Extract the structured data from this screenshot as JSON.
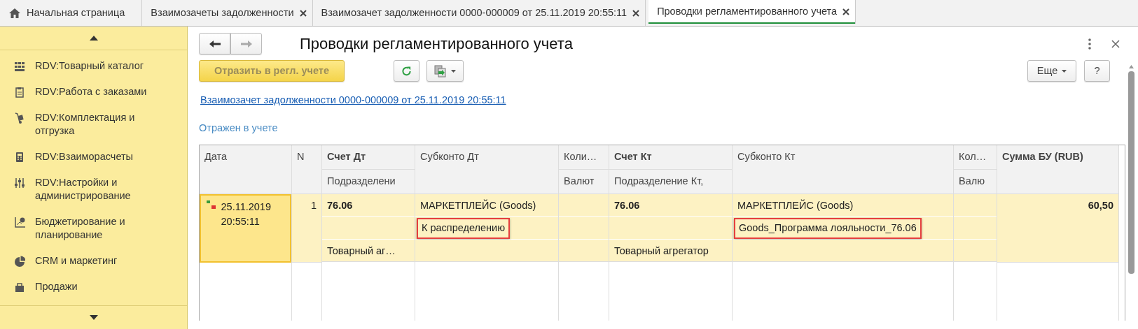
{
  "tabs": [
    {
      "label": "Начальная страница",
      "kind": "home",
      "selected": false
    },
    {
      "label": "Взаимозачеты задолженности",
      "kind": "doc",
      "selected": false
    },
    {
      "label": "Взаимозачет задолженности 0000-000009 от 25.11.2019 20:55:11",
      "kind": "doc",
      "selected": false
    },
    {
      "label": "Проводки регламентированного учета",
      "kind": "doc",
      "selected": true
    }
  ],
  "sidebar": {
    "items": [
      {
        "label": "RDV:Товарный каталог"
      },
      {
        "label": "RDV:Работа с заказами"
      },
      {
        "label": "RDV:Комплектация и отгрузка"
      },
      {
        "label": "RDV:Взаиморасчеты"
      },
      {
        "label": "RDV:Настройки и администрирование"
      },
      {
        "label": "Бюджетирование и планирование"
      },
      {
        "label": "CRM и маркетинг"
      },
      {
        "label": "Продажи"
      }
    ]
  },
  "form": {
    "title": "Проводки регламентированного учета",
    "nav": [
      {
        "kind": "back",
        "disabled": false
      },
      {
        "kind": "forward",
        "disabled": true
      }
    ],
    "post_button": {
      "label": "Отразить в регл. учете",
      "disabled": true
    },
    "more_button": "Еще",
    "help_button": "?",
    "document_link": "Взаимозачет задолженности 0000-000009 от 25.11.2019 20:55:11",
    "status": "Отражен в учете"
  },
  "table": {
    "columns": [
      {
        "headers": [
          "Дата"
        ],
        "bold": false,
        "kind": "text"
      },
      {
        "headers": [
          "N"
        ],
        "bold": false,
        "kind": "number"
      },
      {
        "headers": [
          "Счет Дт",
          "Подразделени"
        ],
        "bold": true,
        "kind": "text"
      },
      {
        "headers": [
          "Субконто Дт"
        ],
        "bold": false,
        "kind": "text"
      },
      {
        "headers": [
          "Коли…",
          "Валют"
        ],
        "bold": false,
        "kind": "text"
      },
      {
        "headers": [
          "Счет Кт",
          "Подразделение Кт,"
        ],
        "bold": true,
        "kind": "text"
      },
      {
        "headers": [
          "Субконто Кт"
        ],
        "bold": false,
        "kind": "text"
      },
      {
        "headers": [
          "Кол…",
          "Валю"
        ],
        "bold": false,
        "kind": "text"
      },
      {
        "headers": [
          "Сумма БУ (RUB)"
        ],
        "bold": true,
        "kind": "number"
      }
    ],
    "rows": [
      {
        "selected": true,
        "cells": [
          {
            "lines": [
              {
                "text": "25.11.2019 20:55:11",
                "highlighted": false
              }
            ],
            "selected": true
          },
          {
            "lines": [
              {
                "text": "1",
                "highlighted": false
              }
            ]
          },
          {
            "lines": [
              {
                "text": "76.06",
                "highlighted": false
              },
              {
                "highlighted": false
              },
              {
                "text": "Товарный аг…",
                "highlighted": false
              }
            ]
          },
          {
            "lines": [
              {
                "text": "МАРКЕТПЛЕЙС (Goods)",
                "highlighted": false
              },
              {
                "text": "К распределению",
                "highlighted": true
              },
              {
                "highlighted": false
              }
            ]
          },
          {
            "lines": [
              {
                "highlighted": false
              },
              {
                "highlighted": false
              },
              {
                "highlighted": false
              }
            ]
          },
          {
            "lines": [
              {
                "text": "76.06",
                "highlighted": false
              },
              {
                "highlighted": false
              },
              {
                "text": "Товарный агрегатор",
                "highlighted": false
              }
            ]
          },
          {
            "lines": [
              {
                "text": "МАРКЕТПЛЕЙС (Goods)",
                "highlighted": false
              },
              {
                "text": "Goods_Программа лояльности_76.06",
                "highlighted": true
              },
              {
                "highlighted": false
              }
            ]
          },
          {
            "lines": [
              {
                "highlighted": false
              },
              {
                "highlighted": false
              },
              {
                "highlighted": false
              }
            ]
          },
          {
            "lines": [
              {
                "text": "60,50",
                "highlighted": false
              }
            ]
          }
        ]
      }
    ]
  }
}
